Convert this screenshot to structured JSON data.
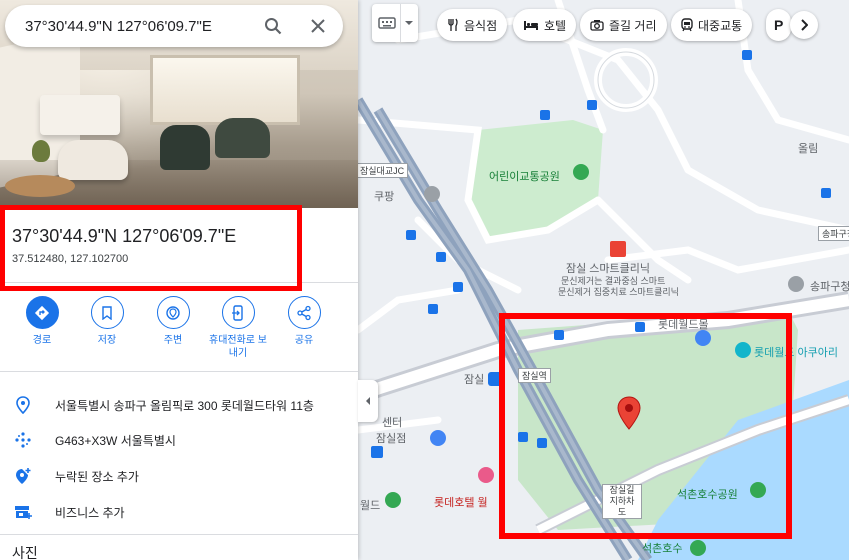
{
  "search": {
    "value": "37°30'44.9\"N 127°06'09.7\"E"
  },
  "place": {
    "title": "37°30'44.9\"N 127°06'09.7\"E",
    "coords": "37.512480, 127.102700"
  },
  "actions": [
    {
      "label": "경로",
      "icon": "directions-icon"
    },
    {
      "label": "저장",
      "icon": "bookmark-icon"
    },
    {
      "label": "주변",
      "icon": "nearby-icon"
    },
    {
      "label": "휴대전화로 보내기",
      "icon": "send-to-phone-icon"
    },
    {
      "label": "공유",
      "icon": "share-icon"
    }
  ],
  "info": {
    "address": "서울특별시 송파구 올림픽로 300 롯데월드타워 11층",
    "plus_code": "G463+X3W 서울특별시",
    "add_missing_place": "누락된 장소 추가",
    "add_business": "비즈니스 추가",
    "photos_heading": "사진"
  },
  "chips": [
    {
      "label": "음식점",
      "icon": "restaurant-icon"
    },
    {
      "label": "호텔",
      "icon": "hotel-icon"
    },
    {
      "label": "즐길 거리",
      "icon": "camera-icon"
    },
    {
      "label": "대중교통",
      "icon": "transit-icon"
    },
    {
      "label": "P",
      "icon": "parking-icon"
    }
  ],
  "map_labels": {
    "children_park": "어린이교통공원",
    "clinic": "잠실 스마트클리닉",
    "clinic_sub1": "문신제거는 결과중심 스마트",
    "clinic_sub2": "문신제거 집중치료 스마트클리닉",
    "lotte_aquarium": "롯데월드 아쿠아리",
    "seokchon_park": "석촌호수공원",
    "seokchon": "석촌호수",
    "lotte_hotel": "롯데호텔 월",
    "jamsil_station": "잠실",
    "jamsil_station_box": "잠실역",
    "jamsil_daegyo": "잠실대교JC",
    "coupang": "쿠팡",
    "songpa_gu": "송파구청",
    "songpa_short": "송파구청",
    "jamsil_store": "잠실점",
    "center": "센터",
    "world": "월드",
    "olympic": "올림",
    "underpass": "잠실길지하차도",
    "lotte_top": "롯데월드몰"
  },
  "colors": {
    "accent": "#1a73e8",
    "highlight": "#ff0000",
    "pin": "#ea4335",
    "park": "#c8e6c9",
    "water": "#aadaff"
  }
}
